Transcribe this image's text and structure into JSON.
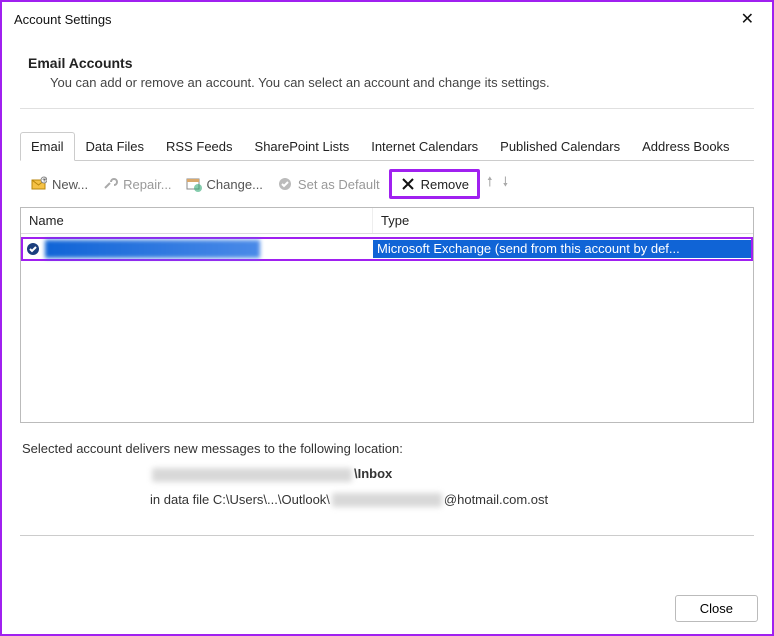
{
  "window": {
    "title": "Account Settings"
  },
  "heading": {
    "title": "Email Accounts",
    "subtitle": "You can add or remove an account. You can select an account and change its settings."
  },
  "tabs": [
    {
      "label": "Email",
      "active": true
    },
    {
      "label": "Data Files"
    },
    {
      "label": "RSS Feeds"
    },
    {
      "label": "SharePoint Lists"
    },
    {
      "label": "Internet Calendars"
    },
    {
      "label": "Published Calendars"
    },
    {
      "label": "Address Books"
    }
  ],
  "toolbar": {
    "new_label": "New...",
    "repair_label": "Repair...",
    "change_label": "Change...",
    "default_label": "Set as Default",
    "remove_label": "Remove"
  },
  "columns": {
    "name": "Name",
    "type": "Type"
  },
  "row": {
    "type_text": "Microsoft Exchange (send from this account by def..."
  },
  "delivery": {
    "intro": "Selected account delivers new messages to the following location:",
    "suffix": "\\Inbox",
    "file_prefix": "in data file C:\\Users\\...\\Outlook\\",
    "file_suffix": "@hotmail.com.ost"
  },
  "footer": {
    "close": "Close"
  }
}
